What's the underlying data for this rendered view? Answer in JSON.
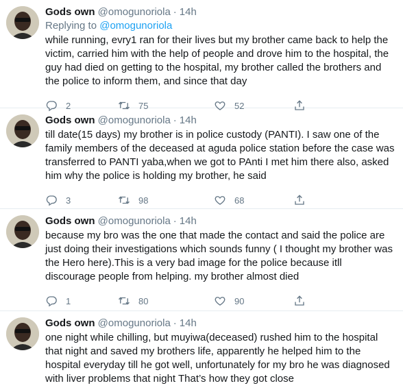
{
  "tweets": [
    {
      "name": "Gods own",
      "handle": "@omogunoriola",
      "time": "14h",
      "replying_prefix": "Replying to ",
      "replying_to": "@omogunoriola",
      "text": "while running, evry1 ran for their lives but my brother came back to help the victim, carried him with the help of people and drove him to the hospital, the guy had died on getting to the hospital, my brother called the brothers and the police to inform them, and since that day",
      "replies": "2",
      "retweets": "75",
      "likes": "52"
    },
    {
      "name": "Gods own",
      "handle": "@omogunoriola",
      "time": "14h",
      "text": "till date(15 days) my brother is in police custody (PANTI). I saw one of the family members of the deceased at aguda police station before the case was transferred to PANTI yaba,when we got to PAnti I met him there also, asked him why the police is holding my brother, he said",
      "replies": "3",
      "retweets": "98",
      "likes": "68"
    },
    {
      "name": "Gods own",
      "handle": "@omogunoriola",
      "time": "14h",
      "text": "because my bro was the one that made the contact and said the police are just doing their investigations which sounds funny ( I thought my brother was the Hero here).This is a very bad image for the police because itll discourage people from helping. my brother almost died",
      "replies": "1",
      "retweets": "80",
      "likes": "90"
    },
    {
      "name": "Gods own",
      "handle": "@omogunoriola",
      "time": "14h",
      "text": "one night while chilling, but muyiwa(deceased) rushed him to the hospital that night and saved my brothers life, apparently he helped him to the hospital everyday till he got well, unfortunately for my bro he was diagnosed with liver problems that night That’s how they got close"
    }
  ],
  "separator": "·",
  "colors": {
    "text": "#14171a",
    "secondary": "#657786",
    "accent": "#1da1f2",
    "divider": "#e6ecf0"
  },
  "icons": [
    "avatar",
    "reply-icon",
    "retweet-icon",
    "like-icon",
    "share-icon"
  ]
}
